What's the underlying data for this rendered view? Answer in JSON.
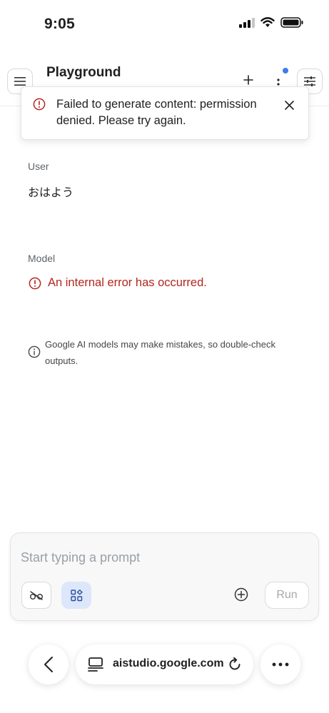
{
  "status_bar": {
    "time": "9:05",
    "icons": [
      "signal-icon",
      "wifi-icon",
      "battery-icon"
    ]
  },
  "header": {
    "title": "Playground",
    "icons": [
      "menu-icon",
      "plus-icon",
      "more-vertical-icon",
      "tune-icon"
    ],
    "notification_dot_color": "#3b7de8"
  },
  "toast": {
    "message": "Failed to generate content: permission denied. Please try again.",
    "icon": "error-circle-icon",
    "error_color": "#b3261e"
  },
  "conversation": {
    "user_label": "User",
    "user_message": "おはよう",
    "model_label": "Model",
    "model_error": "An internal error has occurred.",
    "error_color": "#b3261e"
  },
  "disclaimer": {
    "text": "Google AI models may make mistakes, so double-check outputs.",
    "icon": "info-icon"
  },
  "prompt": {
    "placeholder": "Start typing a prompt",
    "value": "",
    "run_label": "Run",
    "tools": [
      "hide-icon",
      "apps-icon",
      "add-circle-icon"
    ],
    "accent": "#dde7fb"
  },
  "browser": {
    "url": "aistudio.google.com",
    "icons": [
      "back-icon",
      "tabs-icon",
      "reload-icon",
      "more-horizontal-icon"
    ]
  }
}
